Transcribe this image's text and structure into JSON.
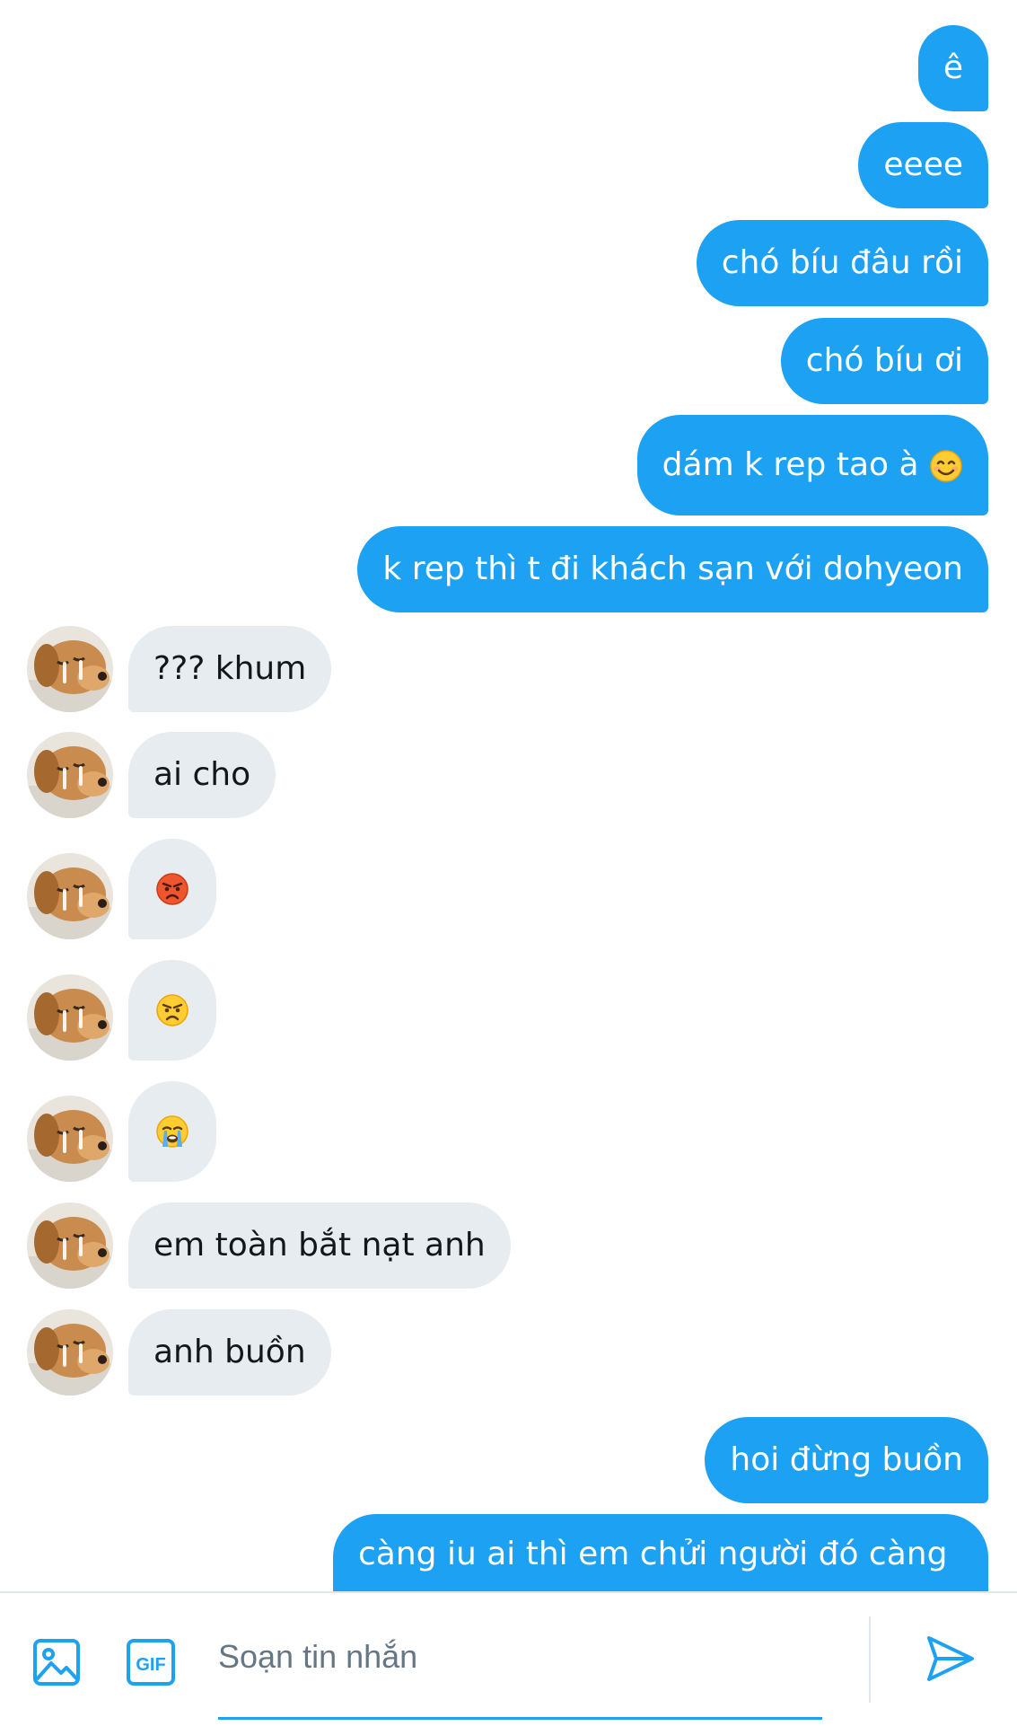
{
  "messages": [
    {
      "dir": "out",
      "text": "ê"
    },
    {
      "dir": "out",
      "text": "eeee"
    },
    {
      "dir": "out",
      "text": "chó bíu đâu rồi"
    },
    {
      "dir": "out",
      "text": "chó bíu ơi"
    },
    {
      "dir": "out",
      "text": "dám k rep tao à",
      "emoji": "smiling-face-emoji"
    },
    {
      "dir": "out",
      "text": "k rep thì t đi khách sạn với dohyeon"
    },
    {
      "dir": "in",
      "text": "??? khum"
    },
    {
      "dir": "in",
      "text": "ai cho"
    },
    {
      "dir": "in",
      "emoji": "pouting-face-emoji"
    },
    {
      "dir": "in",
      "emoji": "angry-face-emoji"
    },
    {
      "dir": "in",
      "emoji": "crying-face-emoji"
    },
    {
      "dir": "in",
      "text": "em toàn bắt nạt anh"
    },
    {
      "dir": "in",
      "text": "anh buồn"
    },
    {
      "dir": "out",
      "text": "hoi đừng buồn"
    },
    {
      "dir": "out",
      "text": "càng iu ai thì em chửi người đó càng"
    }
  ],
  "composer": {
    "placeholder": "Soạn tin nhắn",
    "gif_label": "GIF",
    "icons": [
      "image-icon",
      "gif-icon",
      "send-icon"
    ]
  },
  "colors": {
    "outgoing_bubble": "#1da1f2",
    "incoming_bubble": "#e7ecf0",
    "accent": "#1da1f2"
  }
}
